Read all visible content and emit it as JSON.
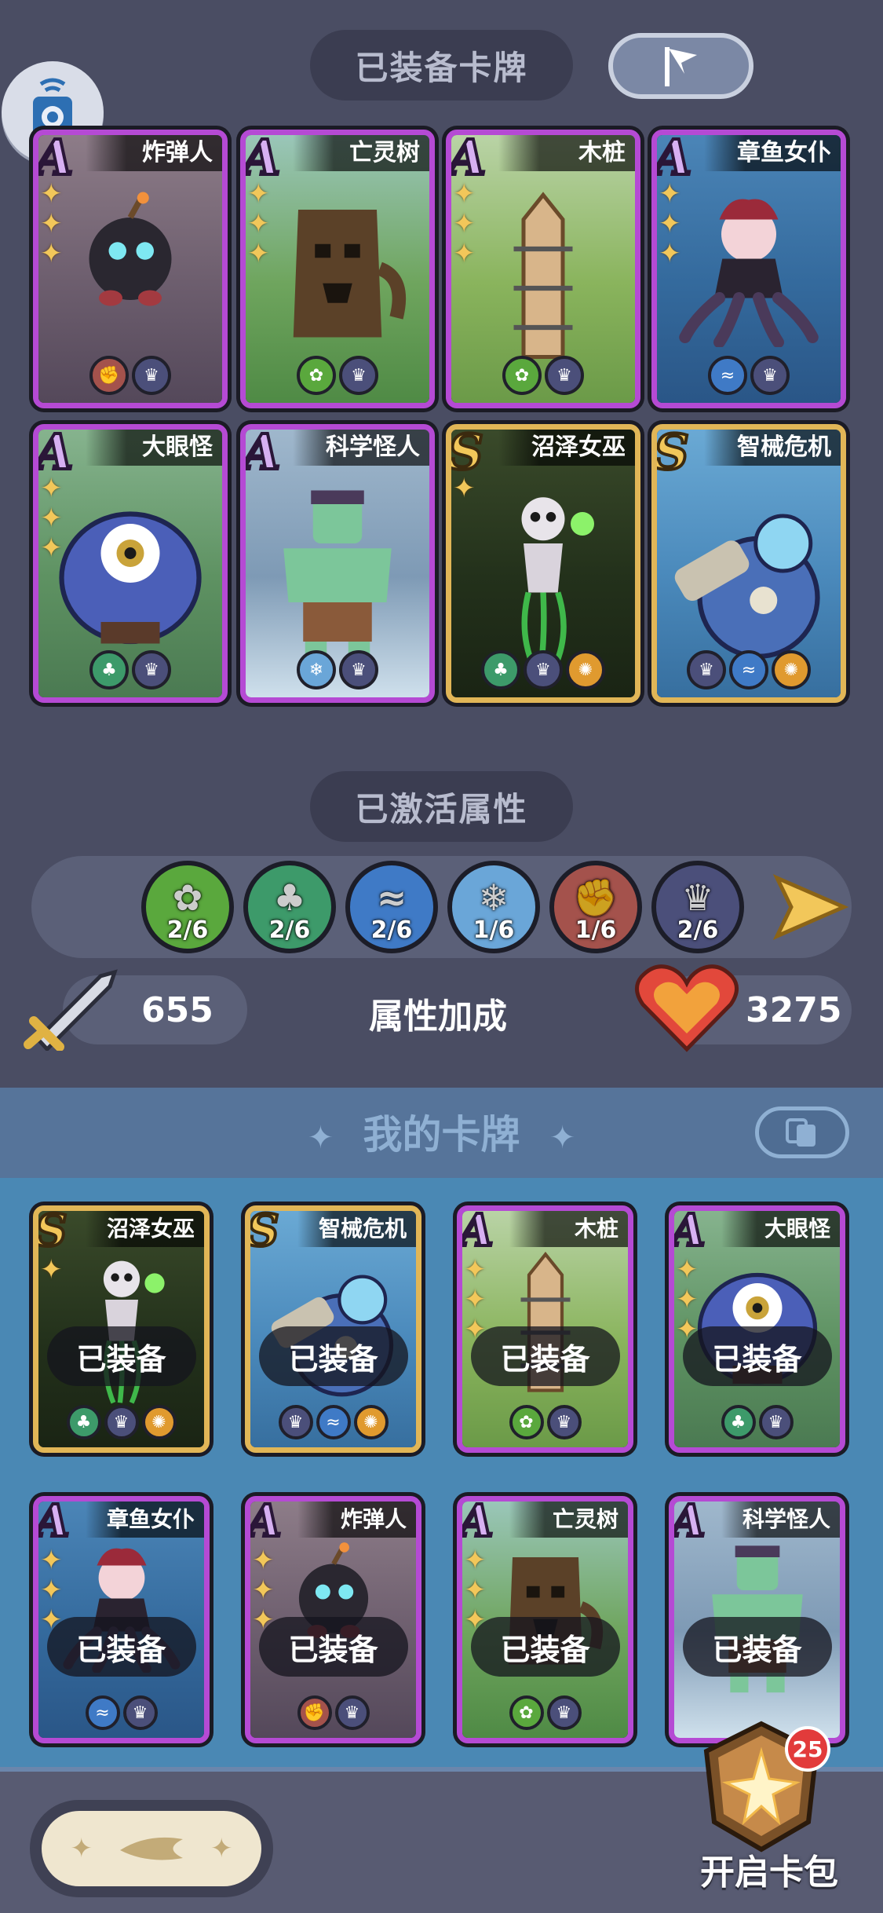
{
  "header": {
    "equipped_title": "已装备卡牌",
    "activated_title": "已激活属性",
    "bonus_title": "属性加成",
    "my_cards_title": "我的卡牌"
  },
  "equipped_cards": [
    {
      "name": "炸弹人",
      "rank": "A",
      "stars": 3,
      "elements": [
        "red",
        "gold"
      ]
    },
    {
      "name": "亡灵树",
      "rank": "A",
      "stars": 3,
      "elements": [
        "green",
        "gold"
      ]
    },
    {
      "name": "木桩",
      "rank": "A",
      "stars": 3,
      "elements": [
        "green",
        "gold"
      ]
    },
    {
      "name": "章鱼女仆",
      "rank": "A",
      "stars": 3,
      "elements": [
        "blue",
        "gold"
      ]
    },
    {
      "name": "大眼怪",
      "rank": "A",
      "stars": 3,
      "elements": [
        "teal",
        "gold"
      ]
    },
    {
      "name": "科学怪人",
      "rank": "A",
      "stars": 0,
      "elements": [
        "ice",
        "gold"
      ]
    },
    {
      "name": "沼泽女巫",
      "rank": "S",
      "stars": 1,
      "elements": [
        "teal",
        "gold",
        "orange"
      ]
    },
    {
      "name": "智械危机",
      "rank": "S",
      "stars": 0,
      "elements": [
        "gold",
        "blue",
        "orange"
      ]
    }
  ],
  "attributes": [
    {
      "count": "2/6",
      "color": "#5aa83d",
      "icon": "grass-icon"
    },
    {
      "count": "2/6",
      "color": "#3d9a6a",
      "icon": "crown-leaf-icon"
    },
    {
      "count": "2/6",
      "color": "#3f7ac6",
      "icon": "wave-icon"
    },
    {
      "count": "1/6",
      "color": "#6aa6d8",
      "icon": "ice-crystal-icon"
    },
    {
      "count": "1/6",
      "color": "#a4524c",
      "icon": "fist-icon"
    },
    {
      "count": "2/6",
      "color": "#4b4f7a",
      "icon": "flame-crown-icon"
    }
  ],
  "stats": {
    "attack": "655",
    "health": "3275"
  },
  "my_cards": [
    {
      "name": "沼泽女巫",
      "rank": "S",
      "stars": 1,
      "status": "已装备",
      "elements": [
        "teal",
        "gold",
        "orange"
      ]
    },
    {
      "name": "智械危机",
      "rank": "S",
      "stars": 0,
      "status": "已装备",
      "elements": [
        "gold",
        "blue",
        "orange"
      ]
    },
    {
      "name": "木桩",
      "rank": "A",
      "stars": 3,
      "status": "已装备",
      "elements": [
        "green",
        "gold"
      ]
    },
    {
      "name": "大眼怪",
      "rank": "A",
      "stars": 3,
      "status": "已装备",
      "elements": [
        "teal",
        "gold"
      ]
    },
    {
      "name": "章鱼女仆",
      "rank": "A",
      "stars": 3,
      "status": "已装备",
      "elements": [
        "blue",
        "gold"
      ]
    },
    {
      "name": "炸弹人",
      "rank": "A",
      "stars": 3,
      "status": "已装备",
      "elements": [
        "red",
        "gold"
      ]
    },
    {
      "name": "亡灵树",
      "rank": "A",
      "stars": 3,
      "status": "已装备",
      "elements": [
        "green",
        "gold"
      ]
    },
    {
      "name": "科学怪人",
      "rank": "A",
      "stars": 0,
      "status": "已装备",
      "elements": []
    }
  ],
  "open_pack": {
    "label": "开启卡包",
    "count": "25"
  }
}
